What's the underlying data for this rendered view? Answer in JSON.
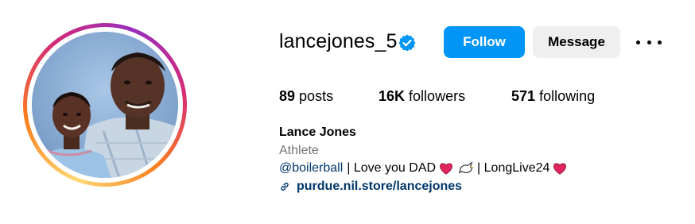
{
  "profile": {
    "username": "lancejones_5",
    "display_name": "Lance Jones",
    "category": "Athlete",
    "verified": true
  },
  "actions": {
    "follow_label": "Follow",
    "message_label": "Message",
    "more_icon": "more-options-icon"
  },
  "stats": {
    "posts_count": "89",
    "posts_label": "posts",
    "followers_count": "16K",
    "followers_label": "followers",
    "following_count": "571",
    "following_label": "following"
  },
  "bio": {
    "mention": "@boilerball",
    "text_1": "| Love you DAD",
    "text_2": "| LongLive24",
    "emojis": [
      "heart-emoji",
      "dove-emoji",
      "heart-emoji"
    ]
  },
  "link": {
    "url": "purdue.nil.store/lancejones",
    "icon": "link-icon"
  },
  "colors": {
    "accent": "#0095f6",
    "link": "#00376b",
    "secondary_text": "#737373",
    "message_button": "#efefef",
    "verified": "#0095f6",
    "heart": "#e0245e"
  }
}
